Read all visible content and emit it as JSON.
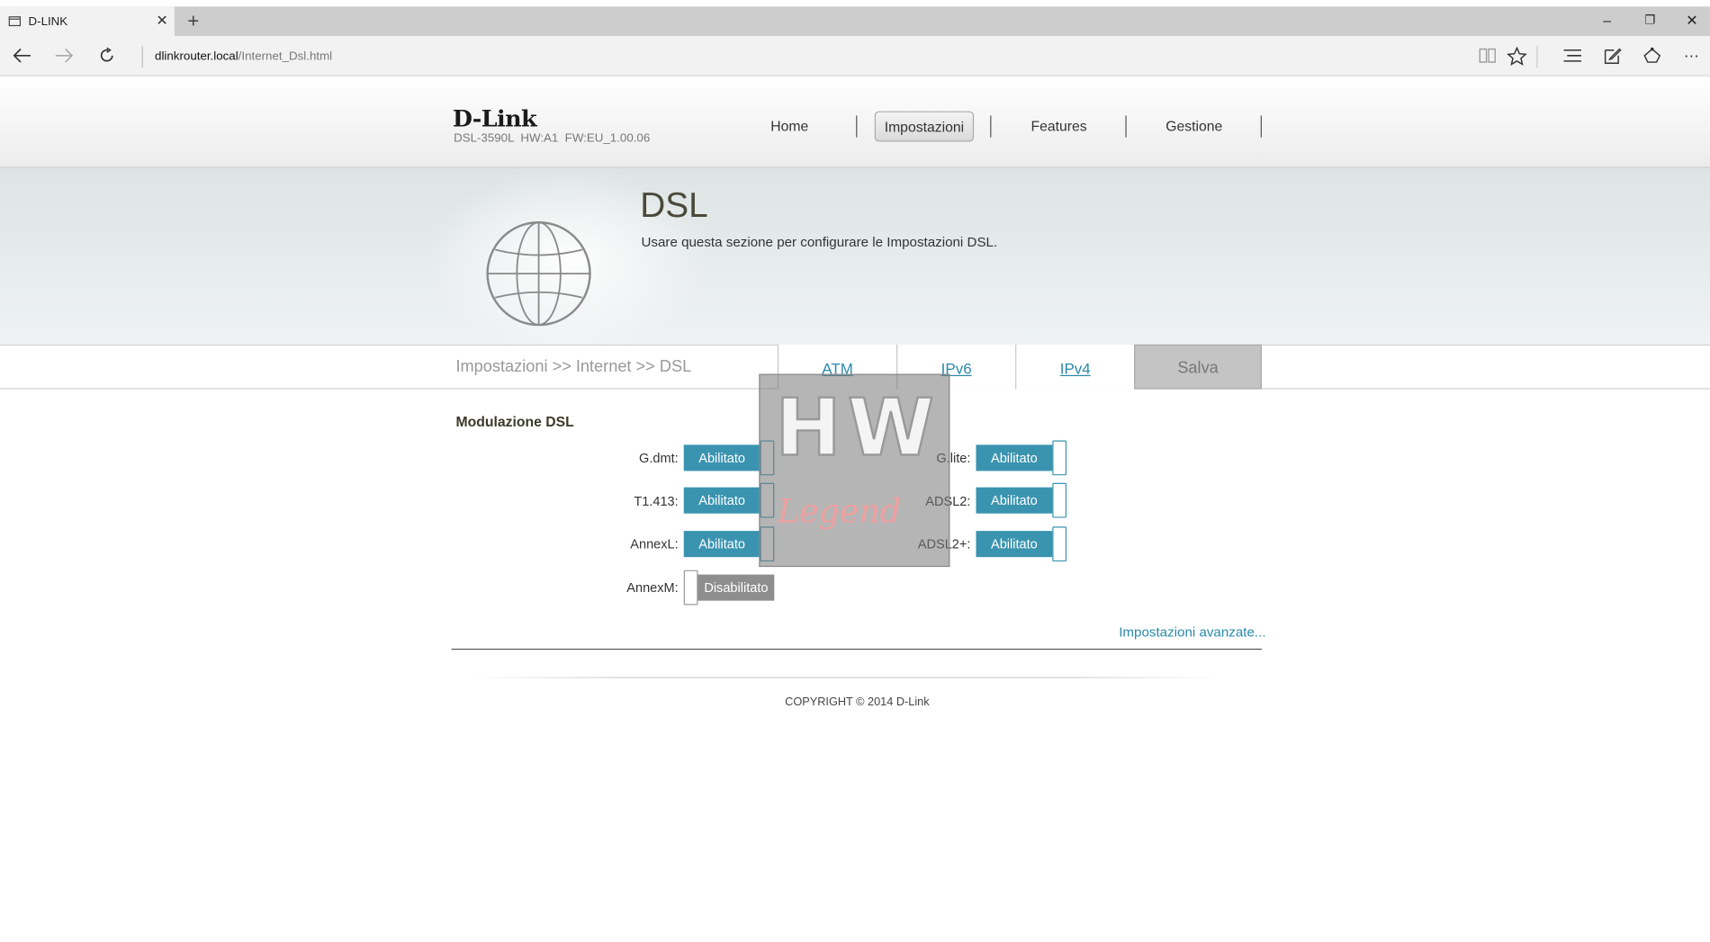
{
  "browser": {
    "tab_title": "D-LINK",
    "tab_close": "✕",
    "new_tab": "+",
    "url_host": "dlinkrouter.local",
    "url_path": "/Internet_Dsl.html",
    "window_controls": [
      "–",
      "❐",
      "✕"
    ],
    "toolbar_icons": [
      "reading-view-icon",
      "favorite-star-icon",
      "hub-icon",
      "web-note-icon",
      "share-icon",
      "more-icon"
    ]
  },
  "header": {
    "logo": "D-Link",
    "model": "DSL-3590L",
    "hw": "HW:A1",
    "fw": "FW:EU_1.00.06",
    "menu": [
      "Home",
      "Impostazioni",
      "Features",
      "Gestione"
    ],
    "active_menu": "Impostazioni"
  },
  "hero": {
    "title": "DSL",
    "description": "Usare questa sezione per configurare le Impostazioni DSL."
  },
  "breadcrumb": "Impostazioni >> Internet >> DSL",
  "page_tabs": [
    "ATM",
    "IPv6",
    "IPv4"
  ],
  "save_label": "Salva",
  "modulation": {
    "title": "Modulazione DSL",
    "left": [
      {
        "label": "G.dmt:",
        "state": "Abilitato"
      },
      {
        "label": "T1.413:",
        "state": "Abilitato"
      },
      {
        "label": "AnnexL:",
        "state": "Abilitato"
      },
      {
        "label": "AnnexM:",
        "state": "Disabilitato"
      }
    ],
    "right": [
      {
        "label": "G.lite:",
        "state": "Abilitato"
      },
      {
        "label": "ADSL2:",
        "state": "Abilitato"
      },
      {
        "label": "ADSL2+:",
        "state": "Abilitato"
      }
    ]
  },
  "advanced_link": "Impostazioni avanzate...",
  "copyright": "COPYRIGHT © 2014 D-Link",
  "watermark": {
    "line1": "HW",
    "line2": "Legend"
  },
  "colors": {
    "accent": "#3a94b0",
    "link": "#2a8aaa",
    "disabled": "#8e8e8e"
  }
}
